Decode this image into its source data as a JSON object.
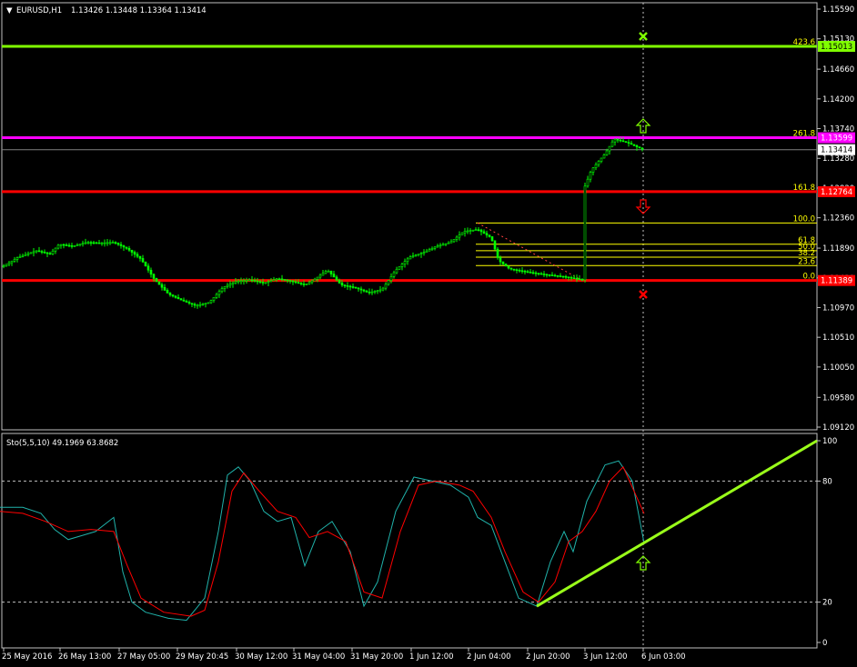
{
  "header": {
    "arrow": "▼",
    "symbol": "EURUSD,H1",
    "ohlc": "1.13426 1.13448 1.13364 1.13414"
  },
  "oscillator": {
    "label": "Sto(5,5,10) 49.1969 63.8682",
    "scale": [
      "100",
      "80",
      "20",
      "0"
    ]
  },
  "price_axis": {
    "ticks": [
      "1.15590",
      "1.15130",
      "1.14660",
      "1.14200",
      "1.13740",
      "1.13280",
      "1.12820",
      "1.12360",
      "1.11890",
      "1.11430",
      "1.10970",
      "1.10510",
      "1.10050",
      "1.09580",
      "1.09120"
    ],
    "badges": {
      "lime": "1.15013",
      "magenta": "1.13599",
      "current": "1.13414",
      "red_upper": "1.12764",
      "red_lower": "1.11389"
    }
  },
  "time_axis": [
    "25 May 2016",
    "26 May 13:00",
    "27 May 05:00",
    "29 May 20:45",
    "30 May 12:00",
    "31 May 04:00",
    "31 May 20:00",
    "1 Jun 12:00",
    "2 Jun 04:00",
    "2 Jun 20:00",
    "3 Jun 12:00",
    "6 Jun 03:00"
  ],
  "levels": {
    "f423": "423.6",
    "f261": "261.8",
    "f161": "161.8",
    "f100": "100.0",
    "f618": "61.8",
    "f500": "50.0",
    "f382": "38.2",
    "f236": "23.6",
    "f000": "0.0"
  },
  "colors": {
    "background": "#000000",
    "candle": "#00ff00",
    "lime_line": "#80ff00",
    "magenta_line": "#ff00ff",
    "red_line": "#ff0000",
    "fib": "#ffff00",
    "stoch_main": "#20b2aa",
    "stoch_signal": "#ff0000",
    "trend": "#9aff1a",
    "grid": "#c0c0c0"
  },
  "chart_data": {
    "type": "candlestick",
    "symbol": "EURUSD",
    "timeframe": "H1",
    "ylim": [
      1.0912,
      1.1559
    ],
    "horizontal_levels": [
      1.15013,
      1.13599,
      1.12764,
      1.11389
    ],
    "current_price": 1.13414,
    "fibonacci": [
      {
        "level": "423.6",
        "price": 1.15013
      },
      {
        "level": "261.8",
        "price": 1.13599
      },
      {
        "level": "161.8",
        "price": 1.12764
      },
      {
        "level": "100.0",
        "price": 1.1228
      },
      {
        "level": "61.8",
        "price": 1.1195
      },
      {
        "level": "50.0",
        "price": 1.1185
      },
      {
        "level": "38.2",
        "price": 1.1175
      },
      {
        "level": "23.6",
        "price": 1.1162
      },
      {
        "level": "0.0",
        "price": 1.11389
      }
    ],
    "close_path": [
      [
        0,
        1.1158
      ],
      [
        20,
        1.1175
      ],
      [
        40,
        1.1185
      ],
      [
        55,
        1.118
      ],
      [
        65,
        1.1195
      ],
      [
        80,
        1.1192
      ],
      [
        95,
        1.1198
      ],
      [
        110,
        1.1197
      ],
      [
        125,
        1.1198
      ],
      [
        140,
        1.1188
      ],
      [
        155,
        1.1172
      ],
      [
        170,
        1.114
      ],
      [
        185,
        1.1118
      ],
      [
        200,
        1.1108
      ],
      [
        215,
        1.11
      ],
      [
        230,
        1.1105
      ],
      [
        245,
        1.1128
      ],
      [
        260,
        1.1138
      ],
      [
        275,
        1.114
      ],
      [
        290,
        1.1135
      ],
      [
        305,
        1.1142
      ],
      [
        320,
        1.1138
      ],
      [
        335,
        1.1132
      ],
      [
        345,
        1.114
      ],
      [
        360,
        1.1155
      ],
      [
        375,
        1.1132
      ],
      [
        390,
        1.1128
      ],
      [
        405,
        1.112
      ],
      [
        420,
        1.1125
      ],
      [
        435,
        1.1155
      ],
      [
        450,
        1.1175
      ],
      [
        465,
        1.1182
      ],
      [
        480,
        1.1192
      ],
      [
        495,
        1.1198
      ],
      [
        510,
        1.1215
      ],
      [
        525,
        1.1218
      ],
      [
        540,
        1.1205
      ],
      [
        548,
        1.117
      ],
      [
        560,
        1.1157
      ],
      [
        580,
        1.1152
      ],
      [
        600,
        1.1148
      ],
      [
        620,
        1.1145
      ],
      [
        640,
        1.114
      ],
      [
        643,
        1.1285
      ],
      [
        650,
        1.131
      ],
      [
        665,
        1.1335
      ],
      [
        675,
        1.1358
      ],
      [
        690,
        1.1352
      ],
      [
        707,
        1.13414
      ]
    ],
    "stochastic": {
      "params": "5,5,10",
      "main_value": 49.1969,
      "signal_value": 63.8682,
      "ylim": [
        0,
        100
      ],
      "levels": [
        20,
        80
      ],
      "main": [
        [
          0,
          67
        ],
        [
          25,
          67
        ],
        [
          45,
          64
        ],
        [
          60,
          56
        ],
        [
          75,
          51
        ],
        [
          90,
          53
        ],
        [
          105,
          55
        ],
        [
          125,
          62
        ],
        [
          135,
          35
        ],
        [
          145,
          20
        ],
        [
          160,
          15
        ],
        [
          185,
          12
        ],
        [
          205,
          11
        ],
        [
          225,
          22
        ],
        [
          240,
          55
        ],
        [
          250,
          83
        ],
        [
          262,
          87
        ],
        [
          275,
          80
        ],
        [
          290,
          65
        ],
        [
          305,
          60
        ],
        [
          320,
          62
        ],
        [
          335,
          38
        ],
        [
          350,
          55
        ],
        [
          365,
          60
        ],
        [
          385,
          45
        ],
        [
          400,
          18
        ],
        [
          415,
          30
        ],
        [
          435,
          65
        ],
        [
          455,
          82
        ],
        [
          475,
          80
        ],
        [
          495,
          78
        ],
        [
          515,
          72
        ],
        [
          525,
          62
        ],
        [
          540,
          58
        ],
        [
          555,
          40
        ],
        [
          570,
          22
        ],
        [
          590,
          18
        ],
        [
          605,
          40
        ],
        [
          620,
          55
        ],
        [
          630,
          45
        ],
        [
          645,
          70
        ],
        [
          665,
          88
        ],
        [
          680,
          90
        ],
        [
          695,
          80
        ],
        [
          708,
          49.1969
        ]
      ],
      "signal": [
        [
          0,
          65
        ],
        [
          25,
          64
        ],
        [
          50,
          60
        ],
        [
          75,
          55
        ],
        [
          100,
          56
        ],
        [
          125,
          55
        ],
        [
          140,
          38
        ],
        [
          155,
          22
        ],
        [
          180,
          15
        ],
        [
          210,
          13
        ],
        [
          225,
          16
        ],
        [
          240,
          40
        ],
        [
          255,
          75
        ],
        [
          268,
          84
        ],
        [
          285,
          75
        ],
        [
          305,
          65
        ],
        [
          325,
          62
        ],
        [
          340,
          52
        ],
        [
          360,
          55
        ],
        [
          380,
          50
        ],
        [
          400,
          25
        ],
        [
          420,
          22
        ],
        [
          440,
          55
        ],
        [
          460,
          78
        ],
        [
          480,
          80
        ],
        [
          505,
          78
        ],
        [
          520,
          75
        ],
        [
          540,
          62
        ],
        [
          555,
          45
        ],
        [
          575,
          25
        ],
        [
          592,
          20
        ],
        [
          610,
          30
        ],
        [
          625,
          50
        ],
        [
          640,
          55
        ],
        [
          655,
          65
        ],
        [
          670,
          80
        ],
        [
          685,
          87
        ],
        [
          708,
          63.8682
        ]
      ]
    }
  }
}
